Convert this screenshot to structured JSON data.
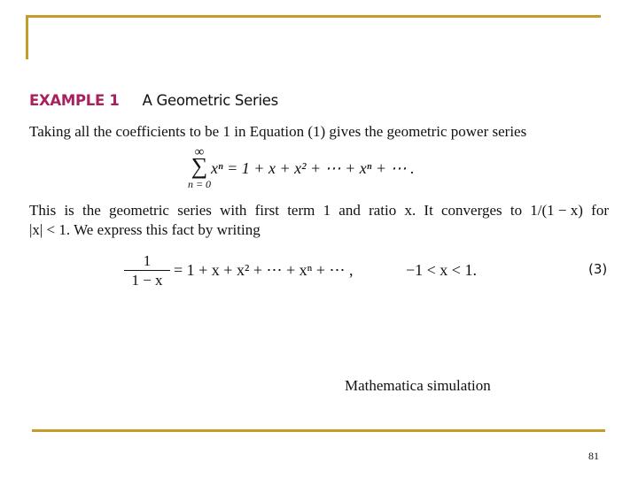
{
  "example": {
    "label": "EXAMPLE 1",
    "title": "A Geometric Series",
    "label_color": "#a8205e"
  },
  "paragraph1": "Taking all the coefficients to be 1 in Equation (1) gives the geometric power series",
  "equation1": {
    "sum_upper": "∞",
    "sum_symbol": "∑",
    "sum_lower": "n = 0",
    "rhs": "xⁿ = 1 + x + x² + ⋯ + xⁿ + ⋯ ."
  },
  "paragraph2": {
    "line1_words": [
      "This",
      "is",
      "the",
      "geometric",
      "series",
      "with",
      "first",
      "term",
      "1",
      "and",
      "ratio",
      "x.",
      "It",
      "converges",
      "to",
      "1/(1 − x)",
      "for"
    ],
    "line2": "|x| < 1. We express this fact by writing"
  },
  "equation3": {
    "numerator": "1",
    "denominator": "1 − x",
    "rhs": "= 1 + x + x² + ⋯ + xⁿ + ⋯ ,",
    "condition": "−1 < x < 1.",
    "tag": "(3)"
  },
  "caption": "Mathematica simulation",
  "page_number": "81",
  "accent_color": "#c29d2a"
}
